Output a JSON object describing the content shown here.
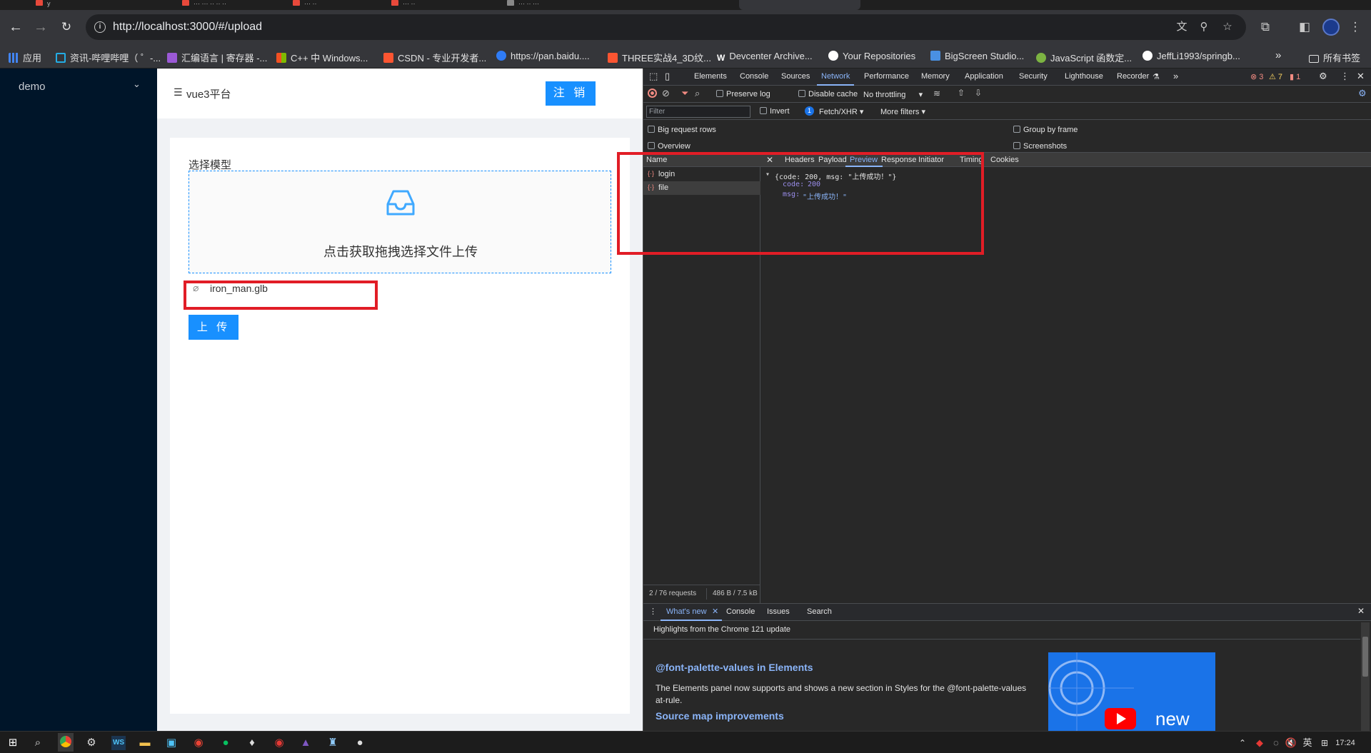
{
  "browser": {
    "url": "http://localhost:3000/#/upload",
    "tabs_partial": [
      "y",
      "··· ··· ·· ·· ··",
      "··· ··",
      "··· ··",
      "··· ·· ···"
    ],
    "bookmarks": [
      {
        "label": "应用",
        "icon": "apps-grid-icon",
        "color": "#4285f4"
      },
      {
        "label": "资讯-哔哩哔哩（ ゜-...",
        "icon": "bilibili-icon",
        "color": "#23ade5"
      },
      {
        "label": "汇编语言 | 寄存器 -...",
        "icon": "visual-studio-icon",
        "color": "#9b59d6"
      },
      {
        "label": "C++ 中 Windows...",
        "icon": "microsoft-icon",
        "color": "#f25022"
      },
      {
        "label": "CSDN - 专业开发者...",
        "icon": "csdn-icon",
        "color": "#fc5531"
      },
      {
        "label": "https://pan.baidu....",
        "icon": "baidu-pan-icon",
        "color": "#2f7cf6"
      },
      {
        "label": "THREE实战4_3D纹...",
        "icon": "csdn-icon",
        "color": "#fc5531"
      },
      {
        "label": "Devcenter Archive...",
        "icon": "w-icon",
        "color": "#ffffff"
      },
      {
        "label": "Your Repositories",
        "icon": "github-icon",
        "color": "#ffffff"
      },
      {
        "label": "BigScreen Studio...",
        "icon": "bigscreen-icon",
        "color": "#4a90e2"
      },
      {
        "label": "JavaScript 函数定...",
        "icon": "js-site-icon",
        "color": "#7cb342"
      },
      {
        "label": "JeffLi1993/springb...",
        "icon": "github-icon",
        "color": "#ffffff"
      }
    ],
    "all_bookmarks": "所有书签"
  },
  "app": {
    "sidebar_menu": "demo",
    "brand": "vue3平台",
    "logout_label": "注 销",
    "section_title": "选择模型",
    "dropzone_hint": "点击获取拖拽选择文件上传",
    "file_name": "iron_man.glb",
    "upload_label": "上 传"
  },
  "devtools": {
    "tabs": [
      "Elements",
      "Console",
      "Sources",
      "Network",
      "Performance",
      "Memory",
      "Application",
      "Security",
      "Lighthouse",
      "Recorder"
    ],
    "active_tab": "Network",
    "badges": {
      "errors": "3",
      "warnings": "7",
      "info": "1"
    },
    "preserve_log": "Preserve log",
    "disable_cache": "Disable cache",
    "throttling": "No throttling",
    "filter_placeholder": "Filter",
    "invert": "Invert",
    "fetch_badge": "1",
    "fetch_filter": "Fetch/XHR",
    "more_filters": "More filters",
    "big_rows": "Big request rows",
    "overview": "Overview",
    "group_by_frame": "Group by frame",
    "screenshots": "Screenshots",
    "name_header": "Name",
    "requests": [
      "login",
      "file"
    ],
    "detail_tabs": [
      "Headers",
      "Payload",
      "Preview",
      "Response",
      "Initiator",
      "Timing",
      "Cookies"
    ],
    "active_detail_tab": "Preview",
    "json_summary": "{code: 200, msg: \"上传成功！\"}",
    "json_code_key": "code",
    "json_code_val": "200",
    "json_msg_key": "msg",
    "json_msg_val": "\"上传成功！\"",
    "status_requests": "2 / 76 requests",
    "status_size": "486 B / 7.5 kB",
    "drawer_tabs": [
      "What's new",
      "Console",
      "Issues",
      "Search"
    ],
    "whatsnew_header": "Highlights from the Chrome 121 update",
    "whatsnew_title": "@font-palette-values in Elements",
    "whatsnew_desc": "The Elements panel now supports and shows a new section in Styles for the @font-palette-values at-rule.",
    "whatsnew_title2": "Source map improvements",
    "thumb_text": "new"
  },
  "taskbar": {
    "ime": "英",
    "time": "17:24"
  },
  "colors": {
    "primary": "#1890ff",
    "sidebar": "#001529",
    "highlight_red": "#e11d26",
    "devtools_link": "#8ab4f8"
  }
}
